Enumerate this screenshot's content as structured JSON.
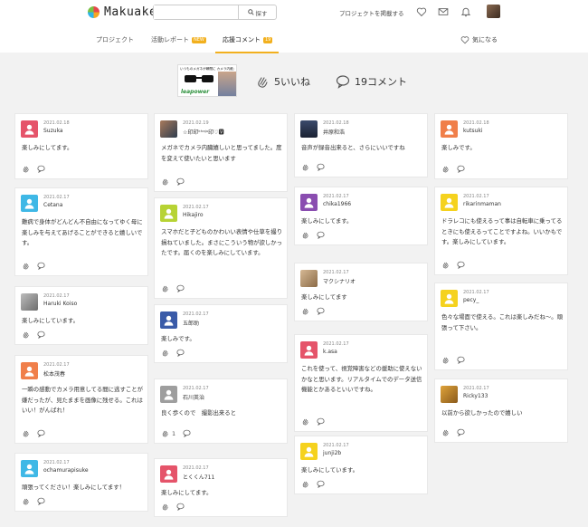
{
  "header": {
    "logo_text": "Makuake",
    "search_placeholder": "",
    "search_button": "探す",
    "post_project": "プロジェクトを掲載する"
  },
  "tabs": [
    {
      "label": "プロジェクト",
      "active": false
    },
    {
      "label": "活動レポート",
      "badge": "NEW",
      "active": false
    },
    {
      "label": "応援コメント",
      "badge": "19",
      "active": true
    }
  ],
  "favorite_label": "気になる",
  "project": {
    "thumb_caption": "いつものメガネが瞬間に カメラ内蔵メガネに",
    "thumb_brand": "leapower"
  },
  "stats": {
    "likes": "5いいね",
    "comments": "19コメント"
  },
  "comments": [
    {
      "date": "2021.02.18",
      "name": "Suzuka",
      "text": "楽しみにしてます。",
      "avatar": "#e5546a",
      "likes": ""
    },
    {
      "date": "2021.02.17",
      "name": "Cetana",
      "text": "難病で身体がどんどん不自由になってゆく母に楽しみを与えてあげることができると嬉しいです。",
      "avatar": "#3fb8e6",
      "likes": ""
    },
    {
      "date": "2021.02.17",
      "name": "Haruki Koiso",
      "text": "楽しみにしています。",
      "avatar": "photo-gray",
      "likes": ""
    },
    {
      "date": "2021.02.17",
      "name": "松本茂春",
      "text": "一瞬の感動でカメラ用意してる間に逃すことが嫌だったが、見たままを画像に残せる。これはいい！がんばれ！",
      "avatar": "#f07f4a",
      "likes": ""
    },
    {
      "date": "2021.02.17",
      "name": "ochamurapisuke",
      "text": "頑張ってください！楽しみにしてます！",
      "avatar": "#3fb8e6",
      "likes": ""
    },
    {
      "date": "2021.02.19",
      "name": "☆印印ᵏʰᵃʲᵘ印♡🆅",
      "text": "メガネでカメラ内臓嬉しいと思ってました。度を変えて使いたいと思います",
      "avatar": "photo-glasses",
      "likes": ""
    },
    {
      "date": "2021.02.17",
      "name": "Hikajiro",
      "text": "スマホだと子どものかわいい表情や仕草を撮り損ねていました。まさにこういう物が欲しかったです。届くのを楽しみにしています。",
      "avatar": "#b7d334",
      "likes": ""
    },
    {
      "date": "2021.02.17",
      "name": "五郎助",
      "text": "楽しみです。",
      "avatar": "#3a5ba8",
      "likes": ""
    },
    {
      "date": "2021.02.17",
      "name": "石川英治",
      "text": "良く歩くので　撮影出来ると",
      "avatar": "#9e9e9e",
      "likes": "1"
    },
    {
      "date": "2021.02.17",
      "name": "とくくん711",
      "text": "楽しみにしてます。",
      "avatar": "#e5546a",
      "likes": ""
    },
    {
      "date": "2021.02.18",
      "name": "井原和浩",
      "text": "音声が録音出来ると、さらにいいですね",
      "avatar": "photo-dusk",
      "likes": ""
    },
    {
      "date": "2021.02.17",
      "name": "chika1966",
      "text": "楽しみにしてます。",
      "avatar": "#8a4db0",
      "likes": ""
    },
    {
      "date": "2021.02.17",
      "name": "マクシナリオ",
      "text": "楽しみにしてます",
      "avatar": "photo-tan",
      "likes": ""
    },
    {
      "date": "2021.02.17",
      "name": "k.asa",
      "text": "これを使って、視覚障害などの援助に使えないかなと思います。リアルタイムでのデータ送信機能とかあるといいですね。",
      "avatar": "#e5546a",
      "likes": ""
    },
    {
      "date": "2021.02.17",
      "name": "junji2b",
      "text": "楽しみにしています。",
      "avatar": "#f5d21e",
      "likes": ""
    },
    {
      "date": "2021.02.18",
      "name": "kutsuki",
      "text": "楽しみです。",
      "avatar": "#f07f4a",
      "likes": ""
    },
    {
      "date": "2021.02.17",
      "name": "rikarinmaman",
      "text": "ドラレコにも使えるって事は自転車に乗ってるときにも使えるってことですよね。いいかもです。楽しみにしています。",
      "avatar": "#f5d21e",
      "likes": ""
    },
    {
      "date": "2021.02.17",
      "name": "pecy_",
      "text": "色々な場面で使える。これは楽しみだね〜。頑張って下さい。",
      "avatar": "#f5d21e",
      "likes": ""
    },
    {
      "date": "2021.02.17",
      "name": "Ricky133",
      "text": "以前から欲しかったので嬉しい",
      "avatar": "photo-food",
      "likes": ""
    }
  ]
}
